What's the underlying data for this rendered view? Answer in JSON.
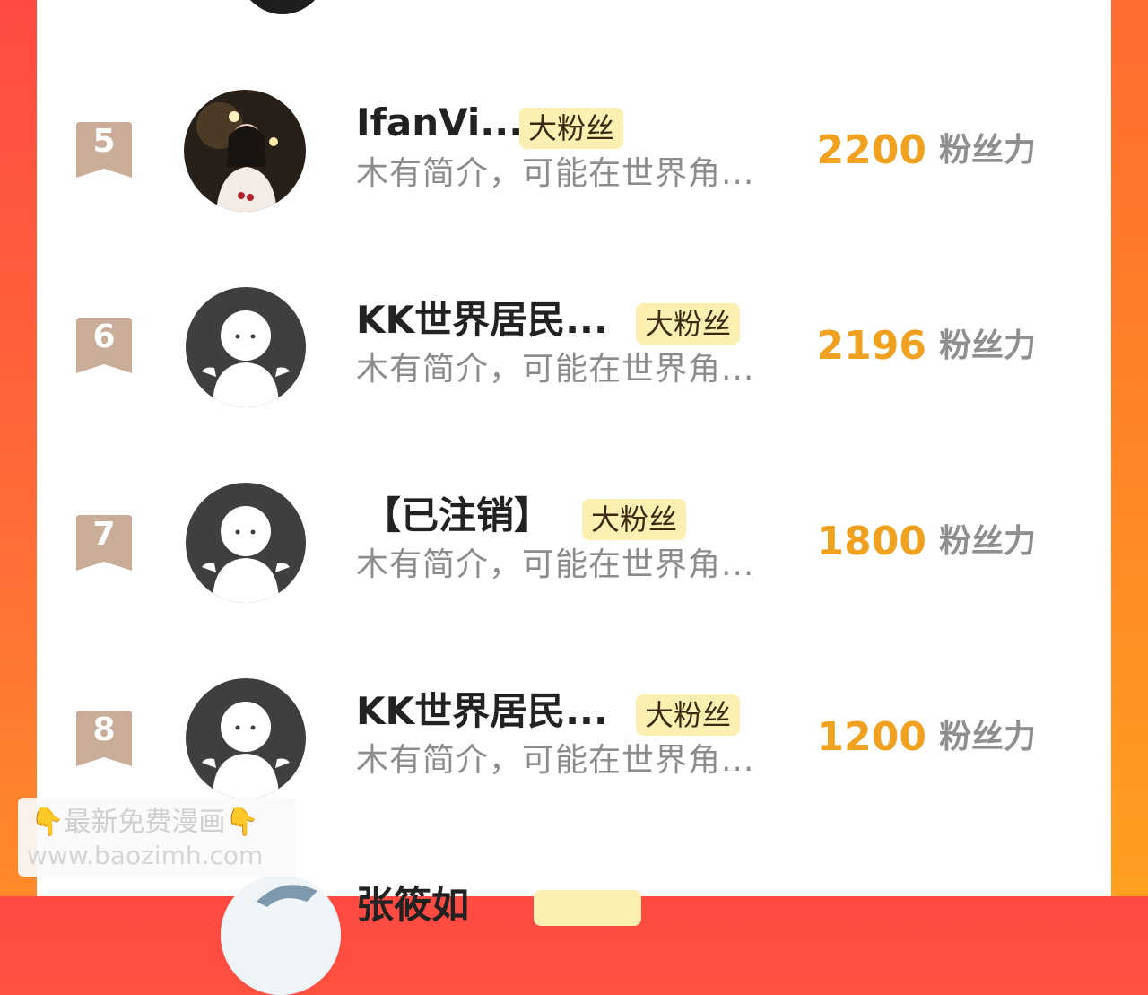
{
  "colors": {
    "count": "#f0a11f",
    "badge_bg": "#fbefb2",
    "rank_ribbon": "#c9ad98",
    "default_avatar_bg": "#3f3f3f",
    "accent_left": "#ff4a42",
    "accent_right": "#ff8a24"
  },
  "rows": [
    {
      "rank": "5",
      "name": "IfanVi...",
      "badge": "大粉丝",
      "bio": "木有简介，可能在世界角...",
      "count": "2200",
      "unit": "粉丝力",
      "avatar": "photo-avatar"
    },
    {
      "rank": "6",
      "name": "KK世界居民...",
      "badge": "大粉丝",
      "bio": "木有简介，可能在世界角...",
      "count": "2196",
      "unit": "粉丝力",
      "avatar": "default-avatar"
    },
    {
      "rank": "7",
      "name": "【已注销】",
      "badge": "大粉丝",
      "bio": "木有简介，可能在世界角...",
      "count": "1800",
      "unit": "粉丝力",
      "avatar": "default-avatar"
    },
    {
      "rank": "8",
      "name": "KK世界居民...",
      "badge": "大粉丝",
      "bio": "木有简介，可能在世界角...",
      "count": "1200",
      "unit": "粉丝力",
      "avatar": "default-avatar"
    }
  ],
  "partial_next": {
    "name": "张筱如"
  },
  "watermark": {
    "line1": "👇最新免费漫画👇",
    "line2": "www.baozimh.com"
  }
}
